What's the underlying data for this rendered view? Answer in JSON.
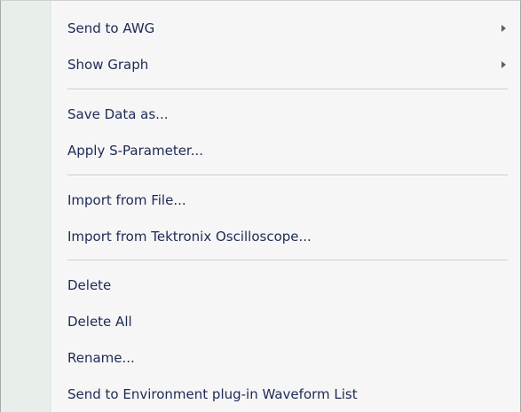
{
  "menu": {
    "items": [
      {
        "label": "Send to AWG",
        "submenu": true
      },
      {
        "label": "Show Graph",
        "submenu": true
      },
      {
        "label": "Save Data as..."
      },
      {
        "label": "Apply S-Parameter..."
      },
      {
        "label": "Import from File..."
      },
      {
        "label": "Import from Tektronix Oscilloscope..."
      },
      {
        "label": "Delete"
      },
      {
        "label": "Delete All"
      },
      {
        "label": "Rename..."
      },
      {
        "label": "Send to Environment plug-in Waveform List"
      }
    ]
  },
  "colors": {
    "text": "#1d2a55",
    "background": "#f6f6f6",
    "gutter": "#e8eeea",
    "separator": "#c5c9cc"
  }
}
